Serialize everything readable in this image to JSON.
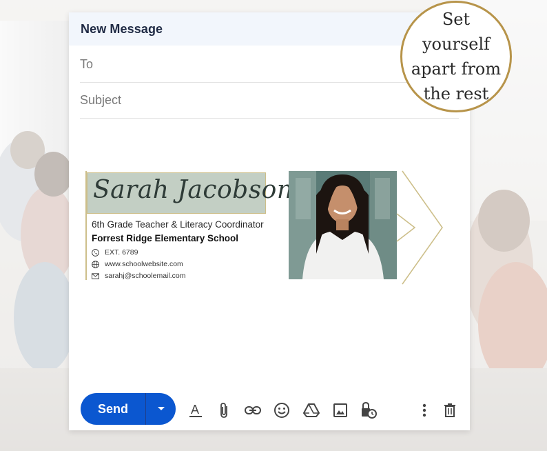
{
  "compose": {
    "title": "New Message",
    "to_label": "To",
    "subject_label": "Subject"
  },
  "signature": {
    "name": "Sarah Jacobson",
    "role": "6th Grade Teacher & Literacy Coordinator",
    "school": "Forrest Ridge Elementary School",
    "phone": "EXT. 6789",
    "website": "www.schoolwebsite.com",
    "email": "sarahj@schoolemail.com",
    "accent_color": "#cdbf8a",
    "name_bg_color": "#c3cfc4"
  },
  "toolbar": {
    "send_label": "Send",
    "send_color": "#0b57d0",
    "icons": [
      "format-text-icon",
      "attach-icon",
      "link-icon",
      "emoji-icon",
      "drive-icon",
      "image-icon",
      "confidential-icon",
      "more-options-icon",
      "trash-icon"
    ]
  },
  "badge": {
    "text": "Set yourself apart from the rest",
    "border_color": "#b7944a"
  }
}
